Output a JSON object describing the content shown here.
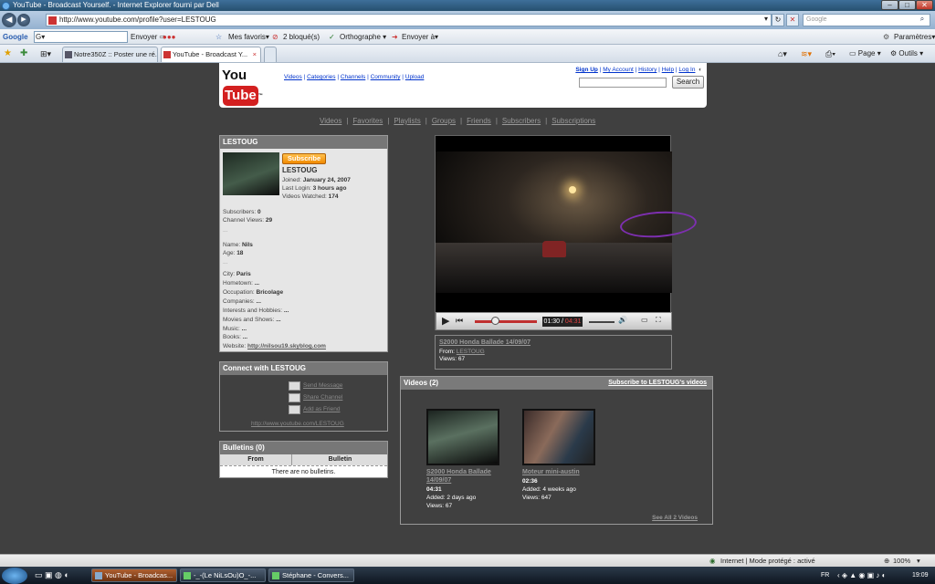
{
  "window": {
    "title": "YouTube - Broadcast Yourself. - Internet Explorer fourni par Dell",
    "minimize": "–",
    "maximize": "□",
    "close": "✕"
  },
  "address_bar": {
    "back": "◀",
    "forward": "▶",
    "url": "http://www.youtube.com/profile?user=LESTOUG",
    "dropdown": "▾",
    "refresh": "↻",
    "stop": "✕",
    "search_placeholder": "Google",
    "search_icon": "⌕"
  },
  "google_toolbar": {
    "logo": "Google",
    "g_btn": "G▾",
    "envoyer": "Envoyer ⇨",
    "mes_favoris": "Mes favoris▾",
    "bloques": "2 bloqué(s)",
    "orthographe": "Orthographe ▾",
    "envoyer_a": "Envoyer à▾",
    "parametres": "Paramètres▾"
  },
  "tabs": [
    {
      "label": "Notre350Z :: Poster une ré..."
    },
    {
      "label": "YouTube - Broadcast Y..."
    }
  ],
  "tab_close": "×",
  "ie_tools": {
    "page": "Page ▾",
    "outils": "Outils ▾"
  },
  "youtube": {
    "logo_you": "You",
    "logo_tube": "Tube",
    "logo_tm": "™",
    "nav": [
      "Videos",
      "Categories",
      "Channels",
      "Community",
      "Upload"
    ],
    "top_links": [
      "Sign Up",
      "My Account",
      "History",
      "Help",
      "Log In"
    ],
    "search_button": "Search",
    "subnav": [
      "Videos",
      "Favorites",
      "Playlists",
      "Groups",
      "Friends",
      "Subscribers",
      "Subscriptions"
    ],
    "subnav_sep": "|"
  },
  "profile": {
    "header": "LESTOUG",
    "subscribe": "Subscribe",
    "name": "LESTOUG",
    "joined_label": "Joined:",
    "joined": "January 24, 2007",
    "last_login_label": "Last Login:",
    "last_login": "3 hours ago",
    "videos_watched_label": "Videos Watched:",
    "videos_watched": "174",
    "subscribers_label": "Subscribers:",
    "subscribers": "0",
    "channel_views_label": "Channel Views:",
    "channel_views": "29",
    "ellipsis": "...",
    "name_label": "Name:",
    "real_name": "Nils",
    "age_label": "Age:",
    "age": "18",
    "city_label": "City:",
    "city": "Paris",
    "hometown_label": "Hometown:",
    "hometown": "...",
    "occupation_label": "Occupation:",
    "occupation": "Bricolage",
    "companies_label": "Companies:",
    "companies": "...",
    "interests_label": "Interests and Hobbies:",
    "interests": "...",
    "movies_label": "Movies and Shows:",
    "movies": "...",
    "music_label": "Music:",
    "music": "...",
    "books_label": "Books:",
    "books": "...",
    "website_label": "Website:",
    "website": "http://nilsou19.skyblog.com"
  },
  "connect": {
    "header": "Connect with LESTOUG",
    "send_message": "Send Message",
    "share_channel": "Share Channel",
    "add_friend": "Add as Friend",
    "channel_url": "http://www.youtube.com/LESTOUG"
  },
  "bulletins": {
    "header": "Bulletins (0)",
    "col_from": "From",
    "col_bulletin": "Bulletin",
    "empty": "There are no bulletins."
  },
  "player": {
    "time_current": "01:30",
    "time_sep": " / ",
    "time_total": "04:31",
    "progress": 0.33,
    "play": "▶",
    "prev": "⏮",
    "volume": "🔊",
    "fullscreen": "⛶"
  },
  "video_info": {
    "title": "S2000 Honda Ballade 14/09/07",
    "from_label": "From:",
    "from": "LESTOUG",
    "views_label": "Views:",
    "views": "67"
  },
  "videos_box": {
    "header": "Videos (2)",
    "subscribe_link": "Subscribe to LESTOUG's videos",
    "see_all": "See All 2 Videos",
    "items": [
      {
        "title_line1": "S2000 Honda Ballade",
        "title_line2": "14/09/07",
        "duration": "04:31",
        "added": "Added: 2 days ago",
        "views": "Views: 67"
      },
      {
        "title_line1": "Moteur mini-austin",
        "title_line2": "",
        "duration": "02:36",
        "added": "Added: 4 weeks ago",
        "views": "Views: 647"
      }
    ]
  },
  "status_bar": {
    "zone": "Internet | Mode protégé : activé",
    "zoom": "100%"
  },
  "taskbar": {
    "buttons": [
      {
        "label": "YouTube - Broadcas..."
      },
      {
        "label": "-_-(Le NiLsOu)O_-..."
      },
      {
        "label": "Stéphane - Convers..."
      }
    ],
    "lang": "FR",
    "time": "19:09"
  }
}
